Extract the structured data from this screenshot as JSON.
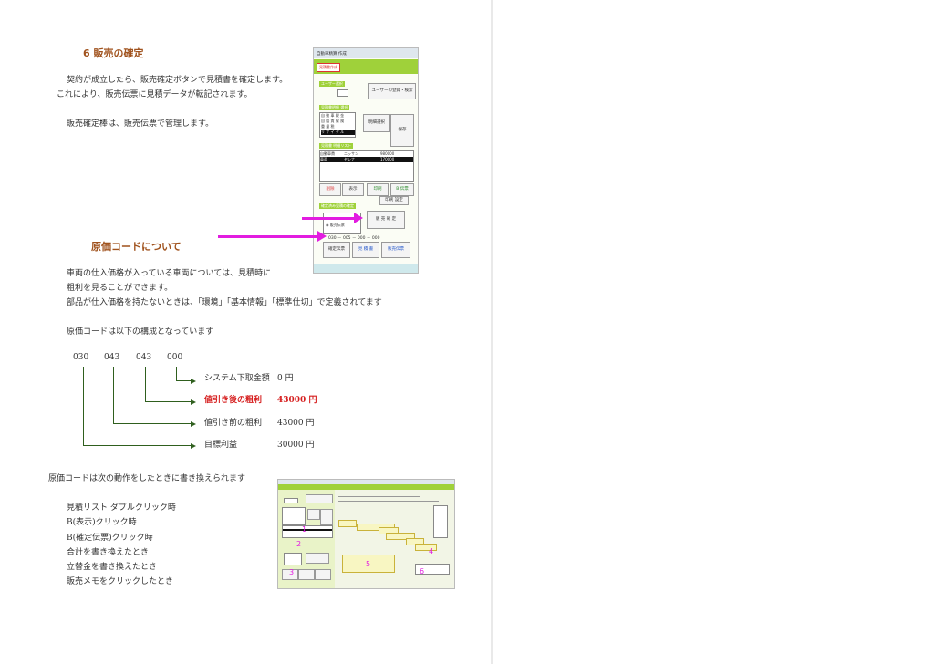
{
  "section6": {
    "title": "6 販売の確定",
    "paragraph1_line1": "契約が成立したら、販売確定ボタンで見積書を確定します。",
    "paragraph1_line2": "これにより、販売伝票に見積データが転記されます。",
    "paragraph2": "販売確定棒は、販売伝票で管理します。"
  },
  "cost_code_section": {
    "title": "原価コードについて",
    "line1": "車両の仕入価格が入っている車両については、見積時に",
    "line2": "粗利を見ることができます。",
    "line3": "部品が仕入価格を持たないときは、「環境」「基本情報」「標準仕切」で定義されてます",
    "line4": "原価コードは以下の構成となっています"
  },
  "code_parts": [
    "030",
    "043",
    "043",
    "000"
  ],
  "code_breakdown": [
    {
      "label": "システム下取金額",
      "value": "0 円",
      "highlight": false
    },
    {
      "label": "値引き後の粗利",
      "value": "43000 円",
      "highlight": true
    },
    {
      "label": "値引き前の粗利",
      "value": "43000 円",
      "highlight": false
    },
    {
      "label": "目標利益",
      "value": "30000 円",
      "highlight": false
    }
  ],
  "rewrite_section": {
    "intro": "原価コードは次の動作をしたときに書き換えられます",
    "items": [
      "見積リスト ダブルクリック時",
      "B(表示)クリック時",
      "B(確定伝票)クリック時",
      "合計を書き換えたとき",
      "立替金を書き換えたとき",
      "販売メモをクリックしたとき"
    ]
  },
  "screenshot1": {
    "window_title": "自動車精算 作成",
    "tab": "見積書作成",
    "user_group": "ユーザー選択",
    "user_btn": "ユーザーの登録・検索",
    "list_group": "見積書明細 選択",
    "list_items": [
      "自 動 車 税 金",
      "自 賠 責 保 険",
      "重 量 税",
      "リ サ イ ク ル"
    ],
    "detail_btn": "明細選択",
    "save_btn": "保存",
    "est_group": "見積書 明細リスト",
    "est_rows": [
      [
        "自動車費",
        "ニッサン",
        "980000"
      ],
      [
        "車両",
        "セレナ",
        "170000"
      ]
    ],
    "b1": "削除",
    "b2": "表示",
    "b3": "印刷",
    "b4": "B 伝票",
    "print_setting": "印刷 設定",
    "confirm_group": "確定済み見積の確定",
    "radio_label": "販売伝票",
    "confirm_btn": "販 売 確 定",
    "code_text": "030 － 005 － 000 － 000",
    "bottom1": "確定伝票",
    "bottom2": "見 積 書",
    "bottom3": "販売伝票"
  },
  "screenshot2": {
    "markers": [
      "1",
      "2",
      "3",
      "4",
      "5",
      "6"
    ]
  }
}
